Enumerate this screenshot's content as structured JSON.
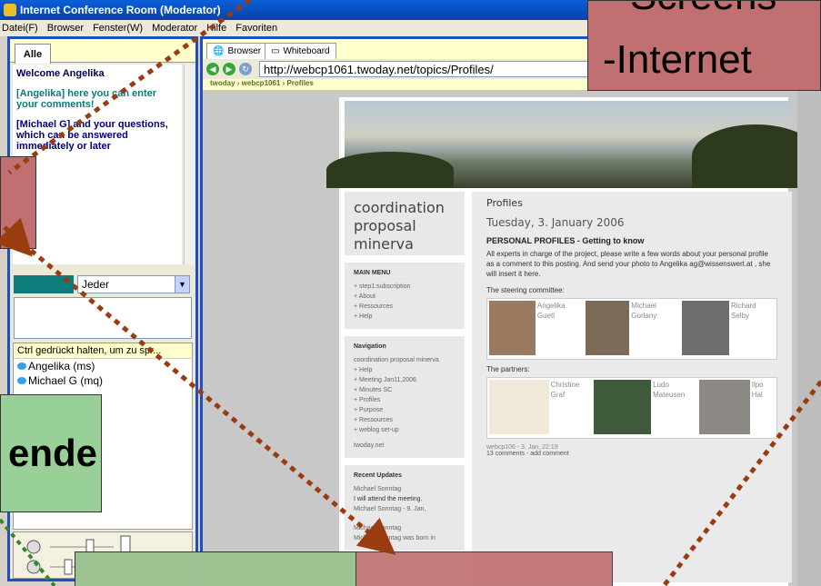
{
  "window": {
    "title": "Internet Conference Room (Moderator)"
  },
  "menu": [
    "Datei(F)",
    "Browser",
    "Fenster(W)",
    "Moderator",
    "Hilfe",
    "Favoriten"
  ],
  "left": {
    "tab": "Alle",
    "chat": {
      "welcome": "Welcome Angelika",
      "msg1": "[Angelika] here you can enter your comments!",
      "msg2": "[Michael G] and your questions, which can be answered immediately or later"
    },
    "recipient_select": "Jeder",
    "userlist_header": "Ctrl gedrückt halten, um zu spr...",
    "users": [
      "Angelika (ms)",
      "Michael G (mq)"
    ]
  },
  "browser": {
    "tabs": [
      "Browser",
      "Whiteboard"
    ],
    "url": "http://webcp1061.twoday.net/topics/Profiles/",
    "breadcrumb": "twoday › webcp1061 › Profiles"
  },
  "site": {
    "brand": "coordination proposal minerva",
    "main_menu_title": "MAIN MENU",
    "main_menu": [
      "+ step1:subscription",
      "+ About",
      "+ Ressources",
      "+ Help"
    ],
    "nav_title": "Navigation",
    "nav_items": [
      "coordination proposal minerva",
      "+ Help",
      "+ Meeting Jan11,2006",
      "+ Minutes SC",
      "+ Profiles",
      "+ Purpose",
      "+ Ressources",
      "+ weblog set-up",
      "twoday.net"
    ],
    "recent_title": "Recent Updates",
    "recent_items": [
      "Michael Sonntag",
      "I will attend the meeting.",
      "Michael Sonntag - 9. Jan,",
      "Michael Sonntag",
      "Michael Sonntag was born in"
    ],
    "page_title": "Profiles",
    "date": "Tuesday, 3. January 2006",
    "post_title": "PERSONAL PROFILES - Getting to know",
    "post_body": "All experts in charge of the project, please write a few words about your personal profile as a comment to this posting. And send your photo to Angelika ag@wissenswert.at , she will insert it here.",
    "committee_label": "The steering committee:",
    "committee": [
      "Angelika Guetl",
      "Michael Gorlany",
      "Richard Selby"
    ],
    "partners_label": "The partners:",
    "partners": [
      "Christine Graf",
      "Ludo Mateusen",
      "Ilpo Hal"
    ],
    "footer_line": "webcp106 - 3. Jan, 22:19",
    "footer_comments": "13 comments - add comment"
  },
  "overlay": {
    "slide_line1": "Screens",
    "slide_line2": "-Internet",
    "green_word": "ende"
  },
  "colors": {
    "titlebar": "#0a5fd8",
    "overlay_red": "#c07070",
    "overlay_green": "#98d098",
    "arrow": "#9a3b10",
    "arrow_green": "#2f8a2f"
  }
}
